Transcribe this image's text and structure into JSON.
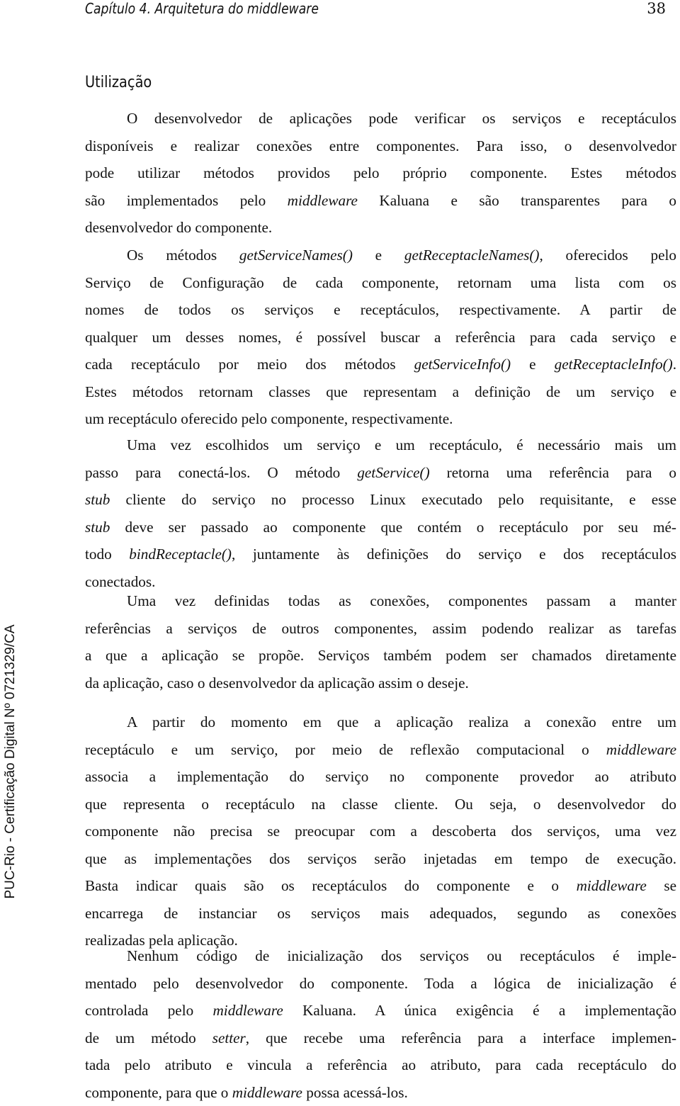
{
  "header": {
    "running_title": "Capítulo 4.  Arquitetura do middleware",
    "page_number": "38"
  },
  "sidebar": {
    "watermark": "PUC-Rio - Certificação Digital Nº 0721329/CA"
  },
  "section": {
    "title": "Utilização"
  },
  "paragraphs": [
    {
      "lines": [
        {
          "indent": true,
          "segments": [
            {
              "t": "O desenvolvedor de aplicações pode verificar os serviços e receptáculos"
            }
          ]
        },
        {
          "segments": [
            {
              "t": "disponíveis e realizar conexões entre componentes. Para isso, o desenvolvedor"
            }
          ]
        },
        {
          "segments": [
            {
              "t": "pode utilizar métodos providos pelo próprio componente. Estes métodos"
            }
          ]
        },
        {
          "segments": [
            {
              "t": "são implementados pelo "
            },
            {
              "t": "middleware",
              "i": true
            },
            {
              "t": " Kaluana e são transparentes para o"
            }
          ]
        },
        {
          "last": true,
          "segments": [
            {
              "t": "desenvolvedor do componente."
            }
          ]
        }
      ]
    },
    {
      "lines": [
        {
          "indent": true,
          "segments": [
            {
              "t": "Os métodos "
            },
            {
              "t": "getServiceNames()",
              "i": true
            },
            {
              "t": " e "
            },
            {
              "t": "getReceptacleNames()",
              "i": true
            },
            {
              "t": ", oferecidos pelo"
            }
          ]
        },
        {
          "segments": [
            {
              "t": "Serviço de Configuração de cada componente, retornam uma lista com os"
            }
          ]
        },
        {
          "segments": [
            {
              "t": "nomes de todos os serviços e receptáculos, respectivamente. A partir de"
            }
          ]
        },
        {
          "segments": [
            {
              "t": "qualquer um desses nomes, é possível buscar a referência para cada serviço e"
            }
          ]
        },
        {
          "segments": [
            {
              "t": "cada receptáculo por meio dos métodos "
            },
            {
              "t": "getServiceInfo()",
              "i": true
            },
            {
              "t": " e "
            },
            {
              "t": "getReceptacleInfo()",
              "i": true
            },
            {
              "t": "."
            }
          ]
        },
        {
          "segments": [
            {
              "t": "Estes métodos retornam classes que representam a definição de um serviço e"
            }
          ]
        },
        {
          "last": true,
          "segments": [
            {
              "t": "um receptáculo oferecido pelo componente, respectivamente."
            }
          ]
        }
      ]
    },
    {
      "lines": [
        {
          "indent": true,
          "segments": [
            {
              "t": "Uma vez escolhidos um serviço e um receptáculo, é necessário mais um"
            }
          ]
        },
        {
          "segments": [
            {
              "t": "passo para conectá-los. O método "
            },
            {
              "t": "getService()",
              "i": true
            },
            {
              "t": " retorna uma referência para o"
            }
          ]
        },
        {
          "segments": [
            {
              "t": "stub",
              "i": true
            },
            {
              "t": " cliente do serviço no processo Linux executado pelo requisitante, e esse"
            }
          ]
        },
        {
          "segments": [
            {
              "t": "stub",
              "i": true
            },
            {
              "t": " deve ser passado ao componente que contém o receptáculo por seu mé-"
            }
          ]
        },
        {
          "segments": [
            {
              "t": "todo "
            },
            {
              "t": "bindReceptacle()",
              "i": true
            },
            {
              "t": ", juntamente às definições do serviço e dos receptáculos"
            }
          ]
        },
        {
          "last": true,
          "segments": [
            {
              "t": "conectados."
            }
          ]
        }
      ]
    },
    {
      "lines": [
        {
          "indent": true,
          "segments": [
            {
              "t": "Uma vez definidas todas as conexões, componentes passam a manter"
            }
          ]
        },
        {
          "segments": [
            {
              "t": "referências a serviços de outros componentes, assim podendo realizar as tarefas"
            }
          ]
        },
        {
          "segments": [
            {
              "t": "a que a aplicação se propõe. Serviços também podem ser chamados diretamente"
            }
          ]
        },
        {
          "last": true,
          "segments": [
            {
              "t": "da aplicação, caso o desenvolvedor da aplicação assim o deseje."
            }
          ]
        }
      ]
    },
    {
      "lines": [
        {
          "indent": true,
          "segments": [
            {
              "t": "A partir do momento em que a aplicação realiza a conexão entre um"
            }
          ]
        },
        {
          "segments": [
            {
              "t": "receptáculo e um serviço, por meio de reflexão computacional o "
            },
            {
              "t": "middleware",
              "i": true
            }
          ]
        },
        {
          "segments": [
            {
              "t": "associa a implementação do serviço no componente provedor ao atributo"
            }
          ]
        },
        {
          "segments": [
            {
              "t": "que representa o receptáculo na classe cliente. Ou seja, o desenvolvedor do"
            }
          ]
        },
        {
          "segments": [
            {
              "t": "componente não precisa se preocupar com a descoberta dos serviços, uma vez"
            }
          ]
        },
        {
          "segments": [
            {
              "t": "que as implementações dos serviços serão injetadas em tempo de execução."
            }
          ]
        },
        {
          "segments": [
            {
              "t": "Basta indicar quais são os receptáculos do componente e o "
            },
            {
              "t": "middleware",
              "i": true
            },
            {
              "t": " se"
            }
          ]
        },
        {
          "segments": [
            {
              "t": "encarrega de instanciar os serviços mais adequados, segundo as conexões"
            }
          ]
        },
        {
          "last": true,
          "segments": [
            {
              "t": "realizadas pela aplicação."
            }
          ]
        }
      ]
    },
    {
      "lines": [
        {
          "indent": true,
          "segments": [
            {
              "t": "Nenhum código de inicialização dos serviços ou receptáculos é imple-"
            }
          ]
        },
        {
          "segments": [
            {
              "t": "mentado pelo desenvolvedor do componente. Toda a lógica de inicialização é"
            }
          ]
        },
        {
          "segments": [
            {
              "t": "controlada pelo "
            },
            {
              "t": "middleware",
              "i": true
            },
            {
              "t": " Kaluana. A única exigência é a implementação"
            }
          ]
        },
        {
          "segments": [
            {
              "t": "de um método "
            },
            {
              "t": "setter",
              "i": true
            },
            {
              "t": ", que recebe uma referência para a interface implemen-"
            }
          ]
        },
        {
          "segments": [
            {
              "t": "tada pelo atributo e vincula a referência ao atributo, para cada receptáculo do"
            }
          ]
        },
        {
          "last": true,
          "segments": [
            {
              "t": "componente, para que o "
            },
            {
              "t": "middleware",
              "i": true
            },
            {
              "t": " possa acessá-los."
            }
          ]
        }
      ]
    }
  ]
}
